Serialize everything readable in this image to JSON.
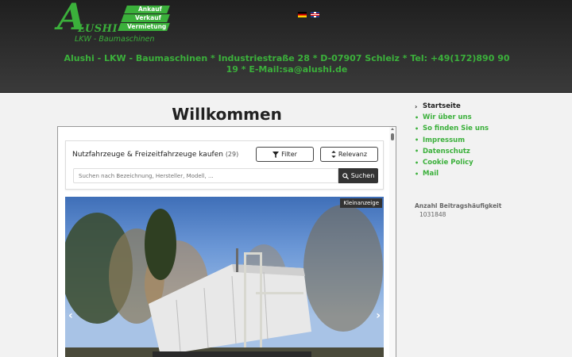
{
  "brand": {
    "logo_initial": "A",
    "logo_name": "LUSHI",
    "logo_subtitle": "LKW - Baumaschinen",
    "tags": [
      "Ankauf",
      "Verkauf",
      "Vermietung"
    ],
    "accent_color": "#3bb03b"
  },
  "languages": [
    {
      "code": "de",
      "icon": "german-flag-icon"
    },
    {
      "code": "en",
      "icon": "uk-flag-icon"
    }
  ],
  "contact_line": "Alushi - LKW - Baumaschinen   *   Industriestraße 28   *   D-07907 Schleiz   *   Tel: +49(172)890 90 19   *   E-Mail:sa@alushi.de",
  "main": {
    "title": "Willkommen",
    "widget": {
      "heading": "Nutzfahrzeuge & Freizeitfahrzeuge kaufen",
      "count": "(29)",
      "filter_label": "Filter",
      "sort_label": "Relevanz",
      "search_placeholder": "Suchen nach Bezeichnung, Hersteller, Modell, ...",
      "search_button": "Suchen",
      "listing_badge": "Kleinanzeige"
    }
  },
  "sidebar": {
    "items": [
      {
        "label": "Startseite",
        "active": true
      },
      {
        "label": "Wir über uns",
        "active": false
      },
      {
        "label": "So finden Sie uns",
        "active": false
      },
      {
        "label": "Impressum",
        "active": false
      },
      {
        "label": "Datenschutz",
        "active": false
      },
      {
        "label": "Cookie Policy",
        "active": false
      },
      {
        "label": "Mail",
        "active": false
      }
    ],
    "stats_label": "Anzahl Beitragshäufigkeit",
    "stats_value": "1031848"
  }
}
